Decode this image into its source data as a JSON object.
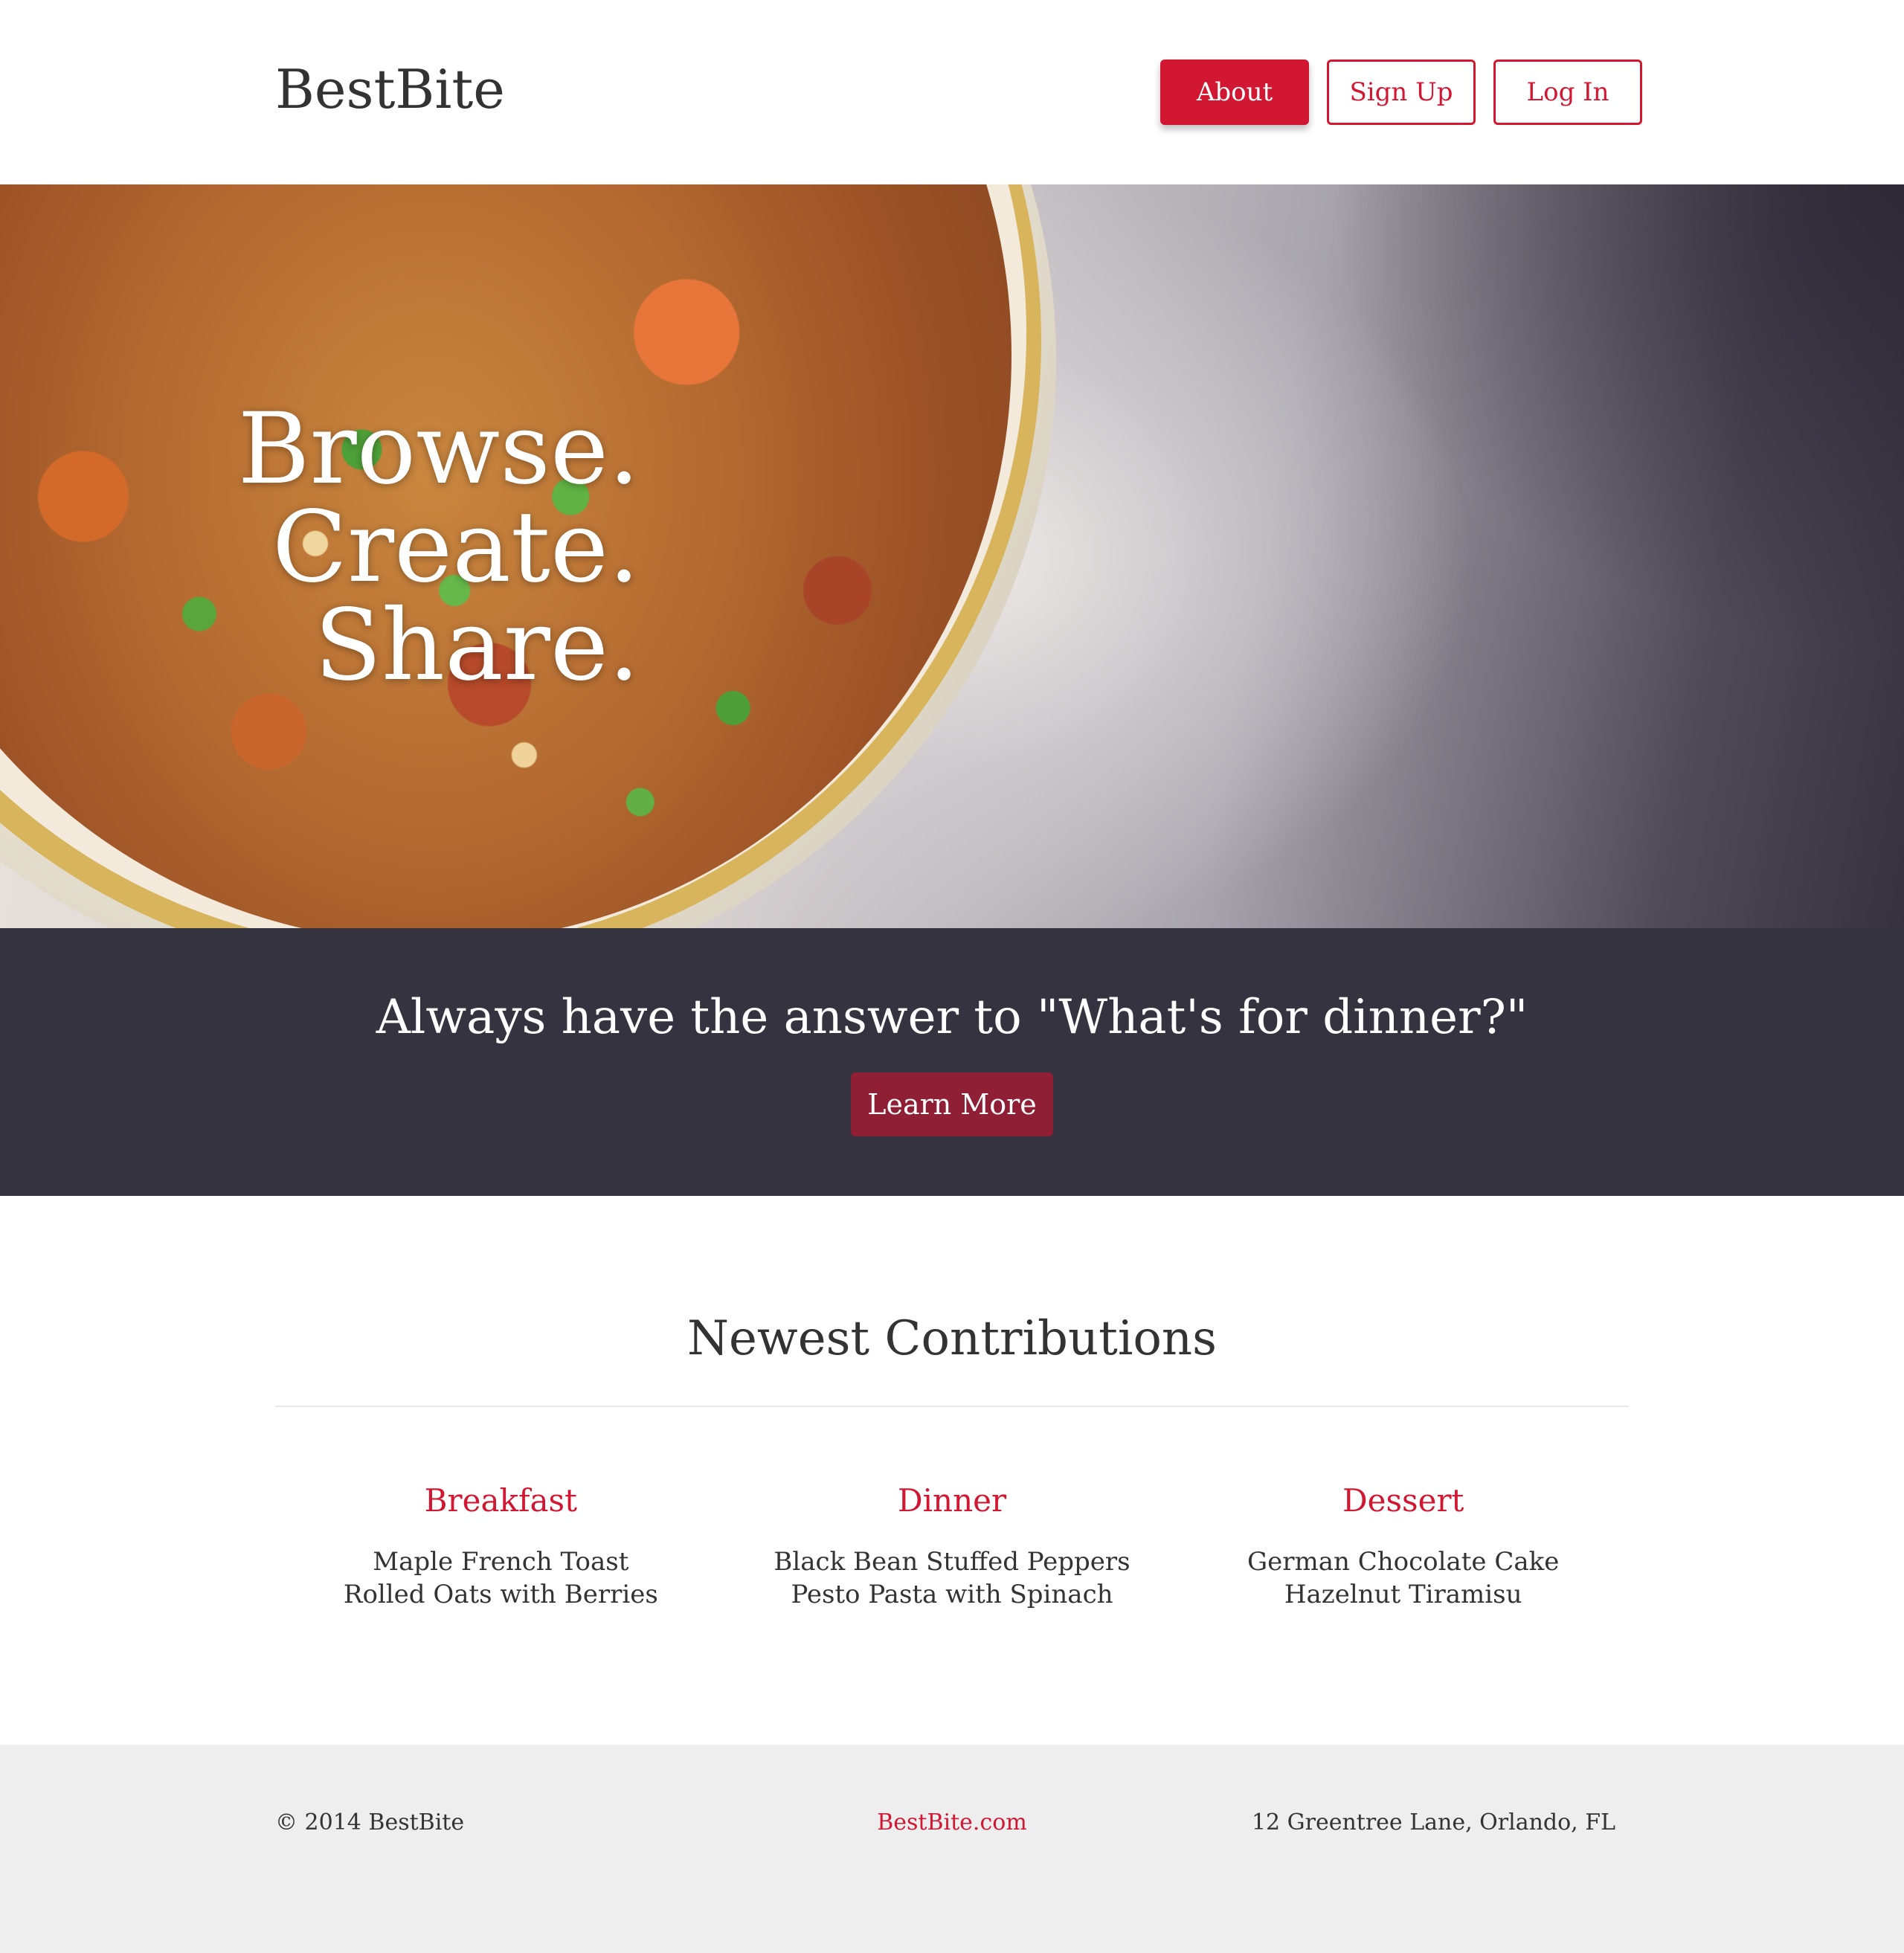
{
  "header": {
    "brand": "BestBite",
    "nav": {
      "about": "About",
      "sign_up": "Sign Up",
      "log_in": "Log In"
    }
  },
  "hero": {
    "lines": [
      "Browse.",
      "Create.",
      "Share."
    ]
  },
  "banner": {
    "title": "Always have the answer to \"What's for dinner?\"",
    "button": "Learn More"
  },
  "contributions": {
    "title": "Newest Contributions",
    "columns": [
      {
        "heading": "Breakfast",
        "items": [
          "Maple French Toast",
          "Rolled Oats with Berries"
        ]
      },
      {
        "heading": "Dinner",
        "items": [
          "Black Bean Stuffed Peppers",
          "Pesto Pasta with Spinach"
        ]
      },
      {
        "heading": "Dessert",
        "items": [
          "German Chocolate Cake",
          "Hazelnut Tiramisu"
        ]
      }
    ]
  },
  "footer": {
    "copyright": "© 2014 BestBite",
    "site_link": "BestBite.com",
    "address": "12 Greentree Lane, Orlando, FL"
  },
  "colors": {
    "accent": "#d21733",
    "banner_bg": "#353340",
    "learn_more_bg": "#8f1f34",
    "footer_bg": "#eeeeee"
  }
}
